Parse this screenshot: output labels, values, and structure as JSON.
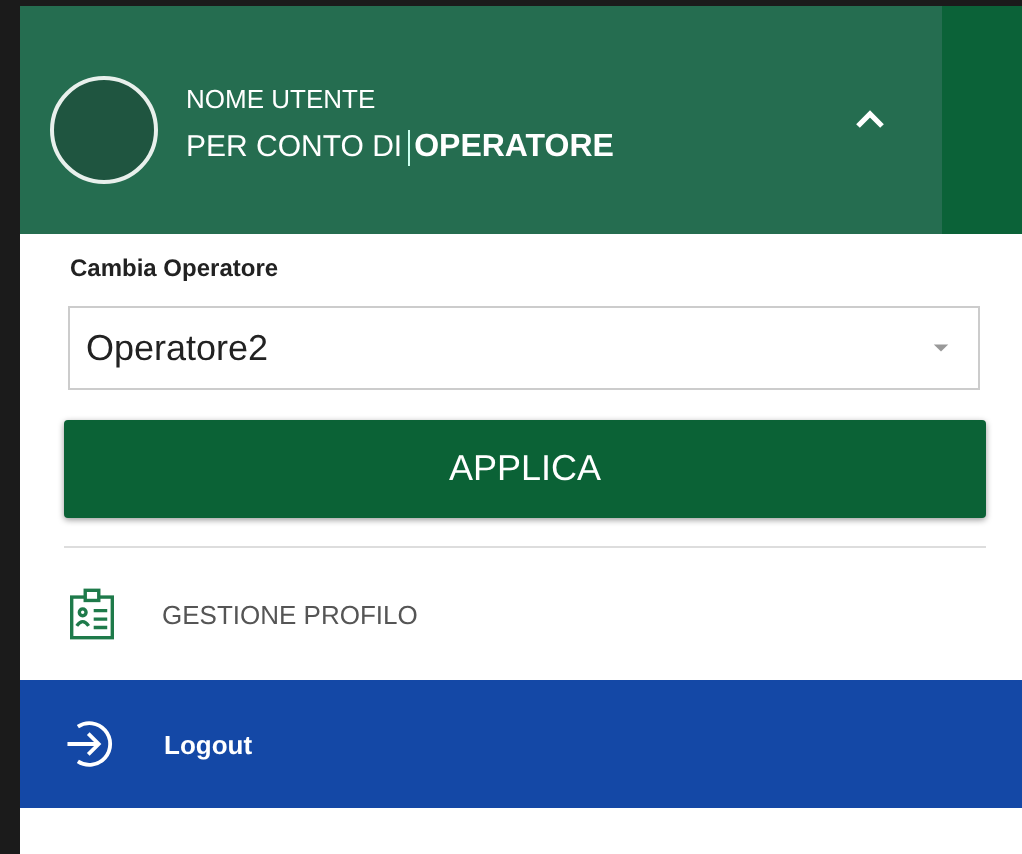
{
  "user_menu": {
    "user_name": "NOME UTENTE",
    "on_behalf_prefix": "PER CONTO DI",
    "on_behalf_name": "OPERATORE",
    "expanded": true
  },
  "operator_switch": {
    "label": "Cambia Operatore",
    "value": "Operatore2",
    "apply_button": "APPLICA"
  },
  "menu_items": [
    {
      "kind": "profile",
      "label": "GESTIONE PROFILO"
    },
    {
      "kind": "logout",
      "label": "Logout"
    }
  ]
}
